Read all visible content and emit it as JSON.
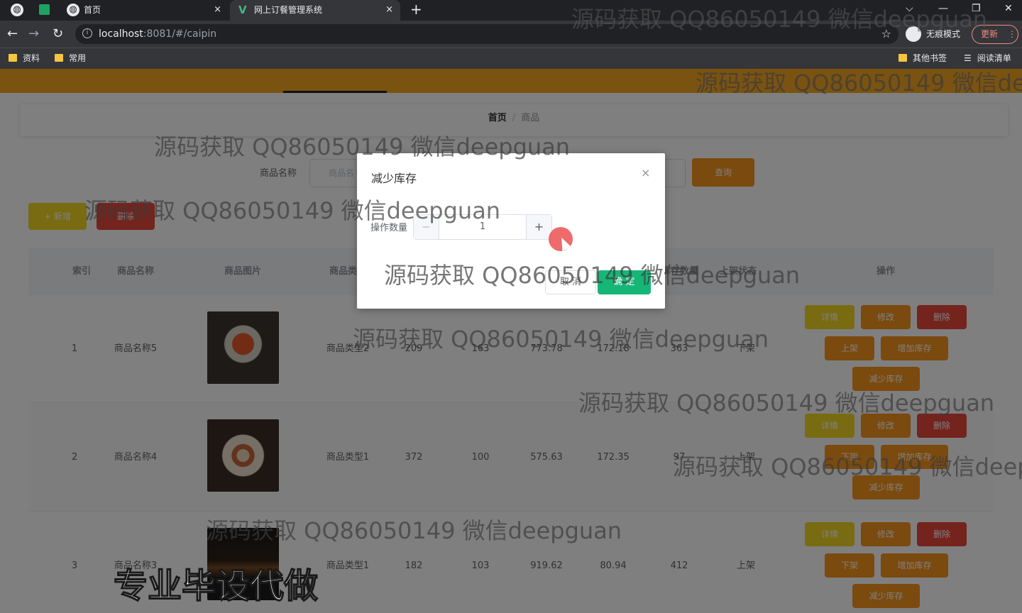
{
  "browser": {
    "tabs": [
      {
        "label": "首页",
        "close": "×"
      },
      {
        "label": "网上订餐管理系统",
        "close": "×"
      }
    ],
    "newtab": "+",
    "url_host": "localhost",
    "url_path": ":8081/#/caipin",
    "incognito_label": "无痕模式",
    "update_label": "更新",
    "bookmarks": [
      "资料",
      "常用"
    ],
    "bookmarks_right": [
      "其他书签",
      "阅读清单"
    ]
  },
  "page": {
    "breadcrumb": {
      "home": "首页",
      "separator": "/",
      "current": "商品"
    },
    "search": {
      "label": "商品名称",
      "placeholder": "商品名",
      "button": "查询"
    },
    "actions": {
      "add": "+ 新增",
      "delete": "删除"
    },
    "table": {
      "headers": [
        "索引",
        "商品名称",
        "商品图片",
        "商品类型",
        "库存数量",
        "上架状态",
        "操作"
      ],
      "rows": [
        {
          "index": "1",
          "name": "商品名称5",
          "type": "商品类型2",
          "c1": "209",
          "c2": "163",
          "c3": "773.78",
          "c4": "172.18",
          "c5": "363",
          "status": "下架",
          "ops": [
            "详情",
            "修改",
            "删除",
            "上架",
            "增加库存",
            "减少库存"
          ]
        },
        {
          "index": "2",
          "name": "商品名称4",
          "type": "商品类型1",
          "c1": "372",
          "c2": "100",
          "c3": "575.63",
          "c4": "172.35",
          "c5": "97",
          "status": "上架",
          "ops": [
            "详情",
            "修改",
            "删除",
            "下架",
            "增加库存",
            "减少库存"
          ]
        },
        {
          "index": "3",
          "name": "商品名称3",
          "type": "商品类型1",
          "c1": "182",
          "c2": "103",
          "c3": "919.62",
          "c4": "80.94",
          "c5": "412",
          "status": "上架",
          "ops": [
            "详情",
            "修改",
            "删除",
            "下架",
            "增加库存",
            "减少库存"
          ]
        }
      ]
    }
  },
  "dialog": {
    "title": "减少库存",
    "close": "×",
    "field_label": "操作数量",
    "value": "1",
    "minus": "−",
    "plus": "+",
    "cancel": "取 消",
    "confirm": "确 定"
  },
  "watermark": "源码获取 QQ86050149 微信deepguan",
  "promo": "专业毕设代做"
}
